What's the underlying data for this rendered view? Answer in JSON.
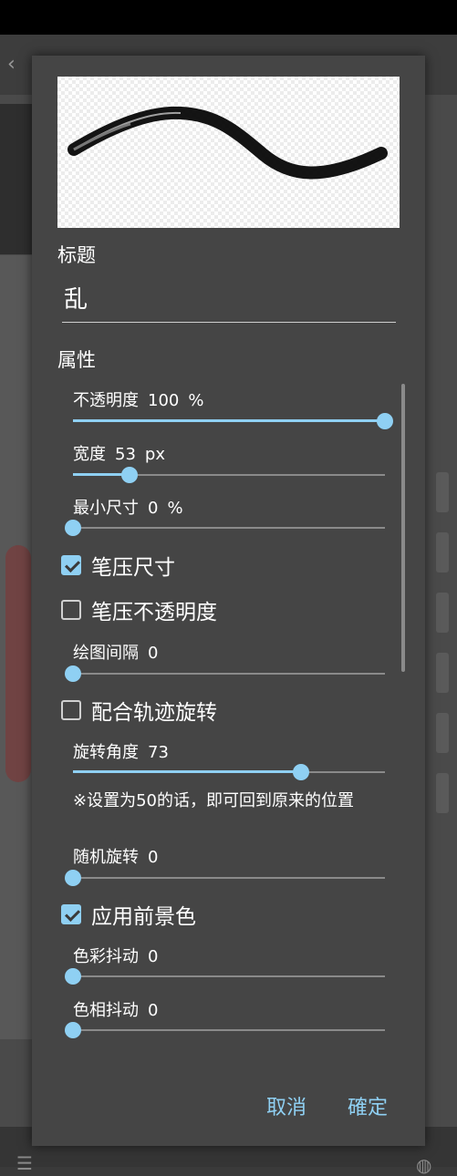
{
  "dialog": {
    "title_label": "标题",
    "title_value": "乱",
    "properties_label": "属性",
    "sliders": [
      {
        "label": "不透明度",
        "value": "100",
        "unit": "%",
        "fraction": 1.0
      },
      {
        "label": "宽度",
        "value": "53",
        "unit": "px",
        "fraction": 0.18
      },
      {
        "label": "最小尺寸",
        "value": "0",
        "unit": "%",
        "fraction": 0.0
      },
      {
        "label": "绘图间隔",
        "value": "0",
        "unit": "",
        "fraction": 0.0
      },
      {
        "label": "旋转角度",
        "value": "73",
        "unit": "",
        "fraction": 0.73
      },
      {
        "label": "随机旋转",
        "value": "0",
        "unit": "",
        "fraction": 0.0
      },
      {
        "label": "色彩抖动",
        "value": "0",
        "unit": "",
        "fraction": 0.0
      },
      {
        "label": "色相抖动",
        "value": "0",
        "unit": "",
        "fraction": 0.0
      }
    ],
    "checkboxes": [
      {
        "label": "笔压尺寸",
        "checked": true
      },
      {
        "label": "笔压不透明度",
        "checked": false
      },
      {
        "label": "配合轨迹旋转",
        "checked": false
      },
      {
        "label": "应用前景色",
        "checked": true
      }
    ],
    "rotation_note": "※设置为50的话，即可回到原来的位置",
    "cancel_label": "取消",
    "ok_label": "確定"
  },
  "colors": {
    "accent": "#8fd0f3",
    "dialog_bg": "#454545",
    "track": "#8a8a8a"
  },
  "icons": [
    "back-arrow-icon",
    "checkmark-icon",
    "menu-icon",
    "globe-icon"
  ]
}
